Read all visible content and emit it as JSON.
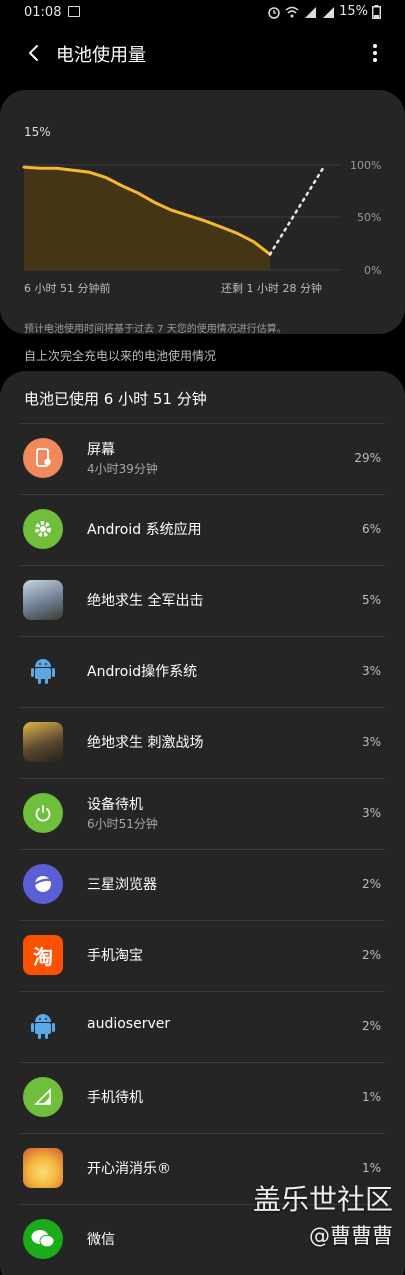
{
  "status": {
    "time": "01:08",
    "battery": "15%"
  },
  "header": {
    "title": "电池使用量"
  },
  "chart": {
    "current_level": "15%",
    "y_labels": [
      "100%",
      "50%",
      "0%"
    ],
    "time_start": "6 小时 51 分钟前",
    "time_remaining": "还剩 1 小时 28 分钟",
    "note": "预计电池使用时间将基于过去 7 天您的使用情况进行估算。",
    "line_color": "#f5b82e"
  },
  "chart_data": {
    "type": "line",
    "ylim": [
      0,
      100
    ],
    "series": [
      {
        "values": [
          98,
          97,
          97,
          95,
          93,
          88,
          80,
          73,
          64,
          57,
          52,
          47,
          41,
          35,
          27,
          15
        ]
      },
      {
        "values": [
          15,
          100
        ]
      }
    ]
  },
  "since_label": "自上次完全充电以来的电池使用情况",
  "usage": {
    "header": "电池已使用 6 小时 51 分钟",
    "apps": [
      {
        "name": "屏幕",
        "sub": "4小时39分钟",
        "pct": "29%",
        "icon": "screen-icon",
        "color": "#f08a5d"
      },
      {
        "name": "Android 系统应用",
        "sub": "",
        "pct": "6%",
        "icon": "gear-icon",
        "color": "#6fbf3d"
      },
      {
        "name": "绝地求生 全军出击",
        "sub": "",
        "pct": "5%",
        "icon": "pubg-quanjun-app-icon",
        "color": "#7a8aa0"
      },
      {
        "name": "Android操作系统",
        "sub": "",
        "pct": "3%",
        "icon": "android-icon",
        "color": "#5aa9e6"
      },
      {
        "name": "绝地求生 刺激战场",
        "sub": "",
        "pct": "3%",
        "icon": "pubg-cijizhanchang-app-icon",
        "color": "#5b4a30"
      },
      {
        "name": "设备待机",
        "sub": "6小时51分钟",
        "pct": "3%",
        "icon": "power-icon",
        "color": "#6fbf3d"
      },
      {
        "name": "三星浏览器",
        "sub": "",
        "pct": "2%",
        "icon": "samsung-internet-icon",
        "color": "#5b5fd6"
      },
      {
        "name": "手机淘宝",
        "sub": "",
        "pct": "2%",
        "icon": "taobao-icon",
        "color": "#ff5000"
      },
      {
        "name": "audioserver",
        "sub": "",
        "pct": "2%",
        "icon": "android-icon",
        "color": "#5aa9e6"
      },
      {
        "name": "手机待机",
        "sub": "",
        "pct": "1%",
        "icon": "signal-icon",
        "color": "#6fbf3d"
      },
      {
        "name": "开心消消乐®",
        "sub": "",
        "pct": "1%",
        "icon": "happy-elimination-icon",
        "color": "#f4b63a"
      },
      {
        "name": "微信",
        "sub": "",
        "pct": "",
        "icon": "wechat-icon",
        "color": "#1aad19"
      }
    ]
  },
  "watermark": {
    "line1": "盖乐世社区",
    "line2": "@曹曹曹"
  }
}
